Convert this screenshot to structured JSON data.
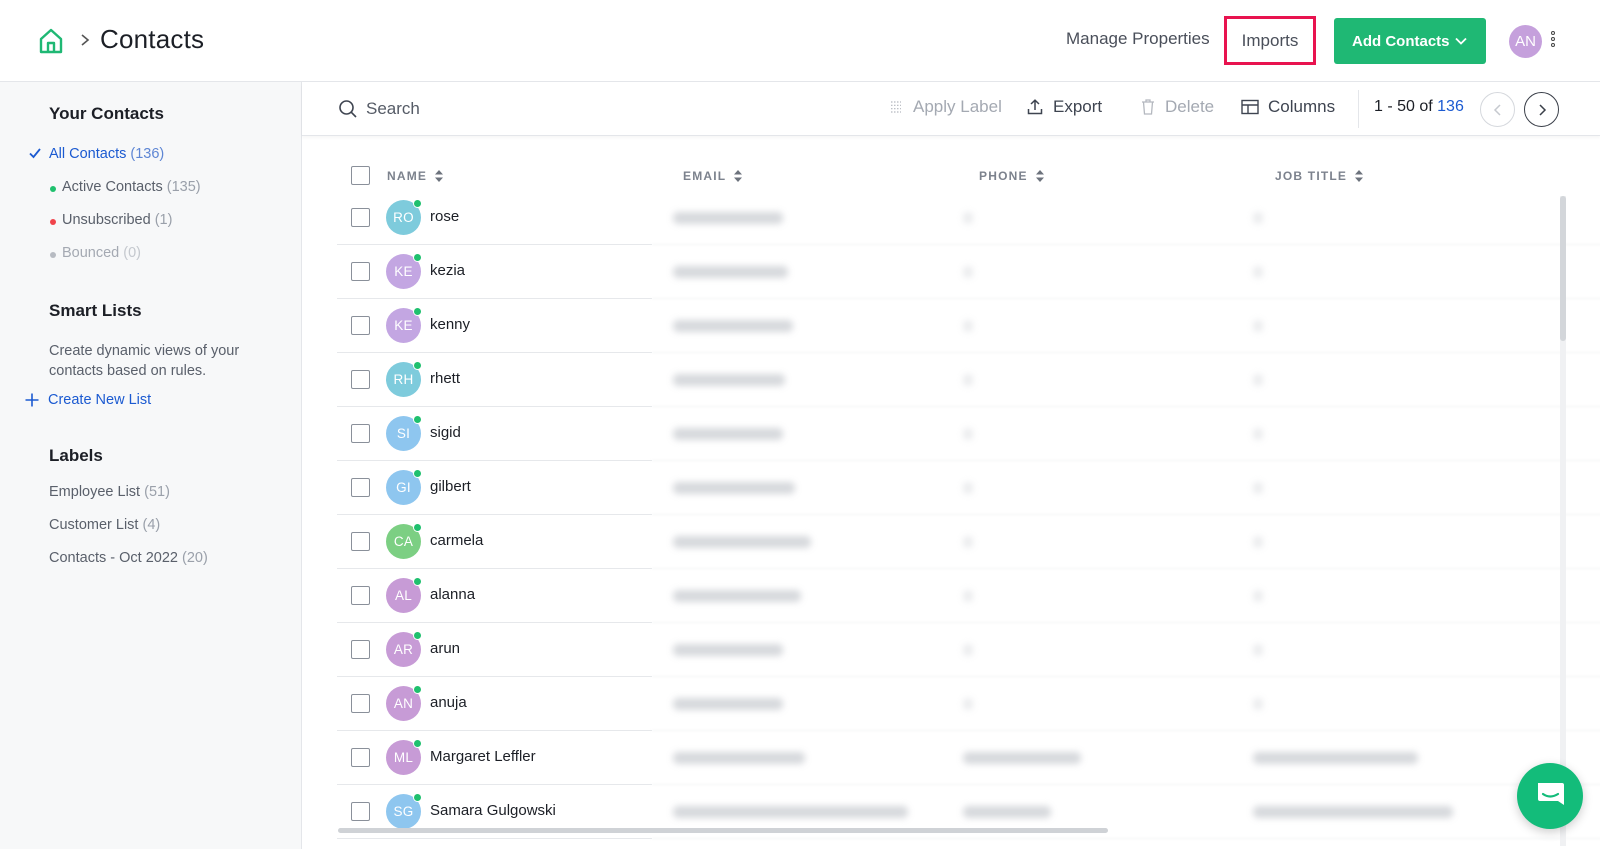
{
  "header": {
    "title": "Contacts",
    "manage_properties": "Manage Properties",
    "imports": "Imports",
    "add_contacts": "Add Contacts",
    "user_initials": "AN"
  },
  "sidebar": {
    "your_contacts_heading": "Your Contacts",
    "contact_filters": [
      {
        "label": "All Contacts",
        "count": "(136)"
      },
      {
        "label": "Active Contacts",
        "count": "(135)"
      },
      {
        "label": "Unsubscribed",
        "count": "(1)"
      },
      {
        "label": "Bounced",
        "count": "(0)"
      }
    ],
    "smart_lists_heading": "Smart Lists",
    "smart_lists_desc": "Create dynamic views of your contacts based on rules.",
    "create_new_list": "Create New List",
    "labels_heading": "Labels",
    "labels": [
      {
        "label": "Employee List",
        "count": "(51)"
      },
      {
        "label": "Customer List",
        "count": "(4)"
      },
      {
        "label": "Contacts - Oct 2022",
        "count": "(20)"
      }
    ]
  },
  "toolbar": {
    "search_placeholder": "Search",
    "apply_label": "Apply Label",
    "export": "Export",
    "delete": "Delete",
    "columns": "Columns",
    "pager_range": "1 - 50 of ",
    "pager_total": "136"
  },
  "table": {
    "columns": [
      "NAME",
      "EMAIL",
      "PHONE",
      "JOB TITLE"
    ],
    "rows": [
      {
        "initials": "RO",
        "name": "rose",
        "color": "#7ecbdc"
      },
      {
        "initials": "KE",
        "name": "kezia",
        "color": "#c3a6e2"
      },
      {
        "initials": "KE",
        "name": "kenny",
        "color": "#c3a6e2"
      },
      {
        "initials": "RH",
        "name": "rhett",
        "color": "#7ecbdc"
      },
      {
        "initials": "SI",
        "name": "sigid",
        "color": "#8ec6ef"
      },
      {
        "initials": "GI",
        "name": "gilbert",
        "color": "#8ec6ef"
      },
      {
        "initials": "CA",
        "name": "carmela",
        "color": "#7ccf83"
      },
      {
        "initials": "AL",
        "name": "alanna",
        "color": "#c79bd6"
      },
      {
        "initials": "AR",
        "name": "arun",
        "color": "#c79bd6"
      },
      {
        "initials": "AN",
        "name": "anuja",
        "color": "#c79bd6"
      },
      {
        "initials": "ML",
        "name": "Margaret Leffler",
        "color": "#c79bd6"
      },
      {
        "initials": "SG",
        "name": "Samara Gulgowski",
        "color": "#8ec6ef"
      }
    ]
  },
  "colors": {
    "brand_green": "#1fb874",
    "link_blue": "#1b5ad1",
    "highlight_red": "#e8134f"
  }
}
